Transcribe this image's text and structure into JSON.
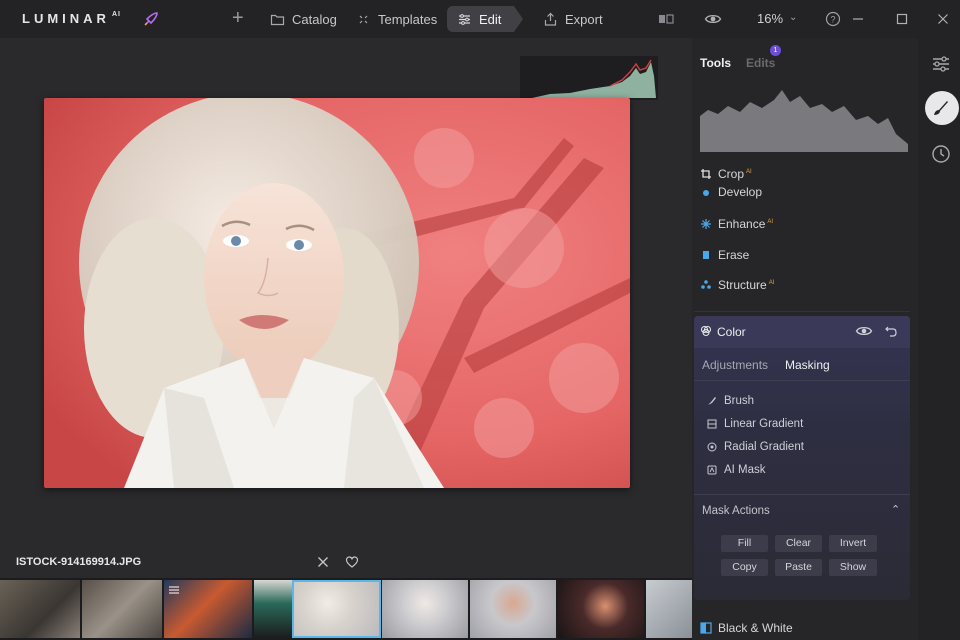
{
  "app": {
    "logo": "LUMINAR",
    "logo_sup": "AI"
  },
  "topbar": {
    "catalog": "Catalog",
    "templates": "Templates",
    "edit": "Edit",
    "export": "Export",
    "zoom": "16%"
  },
  "canvas": {
    "filename": "ISTOCK-914169914.JPG"
  },
  "panel": {
    "tabs": {
      "tools": "Tools",
      "edits": "Edits",
      "edits_badge": "1"
    },
    "tools": [
      {
        "label": "Crop",
        "ai": "AI",
        "icon": "crop-icon"
      },
      {
        "label": "Develop",
        "ai": "",
        "icon": "sun-icon"
      },
      {
        "label": "Enhance",
        "ai": "AI",
        "icon": "sparkle-icon"
      },
      {
        "label": "Erase",
        "ai": "",
        "icon": "eraser-icon"
      },
      {
        "label": "Structure",
        "ai": "AI",
        "icon": "structure-icon"
      }
    ],
    "color": {
      "title": "Color",
      "subtabs": {
        "adjustments": "Adjustments",
        "masking": "Masking"
      },
      "mask_items": [
        "Brush",
        "Linear Gradient",
        "Radial Gradient",
        "AI Mask"
      ],
      "mask_actions_title": "Mask Actions",
      "actions": [
        "Fill",
        "Clear",
        "Invert",
        "Copy",
        "Paste",
        "Show"
      ]
    },
    "black_white": "Black & White"
  },
  "colors": {
    "accent": "#5ab7e8",
    "badge": "#6b4fd8",
    "mask_overlay": "#e05a5a"
  }
}
